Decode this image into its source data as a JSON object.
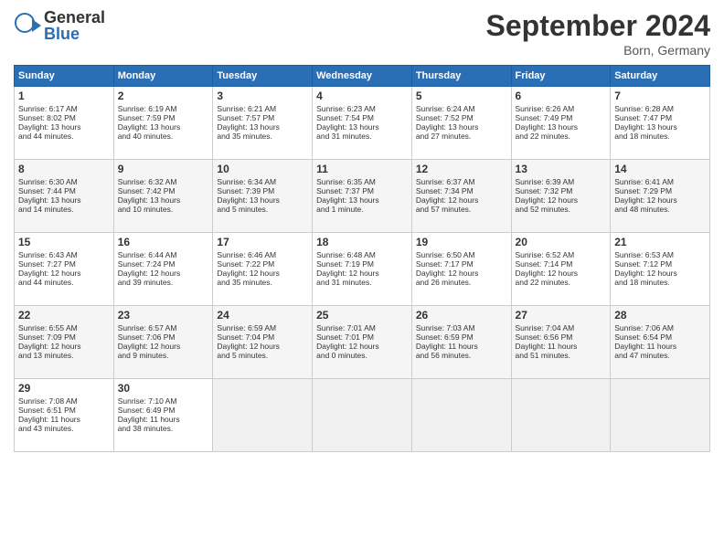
{
  "logo": {
    "general": "General",
    "blue": "Blue"
  },
  "title": "September 2024",
  "location": "Born, Germany",
  "days_header": [
    "Sunday",
    "Monday",
    "Tuesday",
    "Wednesday",
    "Thursday",
    "Friday",
    "Saturday"
  ],
  "weeks": [
    [
      {
        "num": "1",
        "info": "Sunrise: 6:17 AM\nSunset: 8:02 PM\nDaylight: 13 hours\nand 44 minutes."
      },
      {
        "num": "2",
        "info": "Sunrise: 6:19 AM\nSunset: 7:59 PM\nDaylight: 13 hours\nand 40 minutes."
      },
      {
        "num": "3",
        "info": "Sunrise: 6:21 AM\nSunset: 7:57 PM\nDaylight: 13 hours\nand 35 minutes."
      },
      {
        "num": "4",
        "info": "Sunrise: 6:23 AM\nSunset: 7:54 PM\nDaylight: 13 hours\nand 31 minutes."
      },
      {
        "num": "5",
        "info": "Sunrise: 6:24 AM\nSunset: 7:52 PM\nDaylight: 13 hours\nand 27 minutes."
      },
      {
        "num": "6",
        "info": "Sunrise: 6:26 AM\nSunset: 7:49 PM\nDaylight: 13 hours\nand 22 minutes."
      },
      {
        "num": "7",
        "info": "Sunrise: 6:28 AM\nSunset: 7:47 PM\nDaylight: 13 hours\nand 18 minutes."
      }
    ],
    [
      {
        "num": "8",
        "info": "Sunrise: 6:30 AM\nSunset: 7:44 PM\nDaylight: 13 hours\nand 14 minutes."
      },
      {
        "num": "9",
        "info": "Sunrise: 6:32 AM\nSunset: 7:42 PM\nDaylight: 13 hours\nand 10 minutes."
      },
      {
        "num": "10",
        "info": "Sunrise: 6:34 AM\nSunset: 7:39 PM\nDaylight: 13 hours\nand 5 minutes."
      },
      {
        "num": "11",
        "info": "Sunrise: 6:35 AM\nSunset: 7:37 PM\nDaylight: 13 hours\nand 1 minute."
      },
      {
        "num": "12",
        "info": "Sunrise: 6:37 AM\nSunset: 7:34 PM\nDaylight: 12 hours\nand 57 minutes."
      },
      {
        "num": "13",
        "info": "Sunrise: 6:39 AM\nSunset: 7:32 PM\nDaylight: 12 hours\nand 52 minutes."
      },
      {
        "num": "14",
        "info": "Sunrise: 6:41 AM\nSunset: 7:29 PM\nDaylight: 12 hours\nand 48 minutes."
      }
    ],
    [
      {
        "num": "15",
        "info": "Sunrise: 6:43 AM\nSunset: 7:27 PM\nDaylight: 12 hours\nand 44 minutes."
      },
      {
        "num": "16",
        "info": "Sunrise: 6:44 AM\nSunset: 7:24 PM\nDaylight: 12 hours\nand 39 minutes."
      },
      {
        "num": "17",
        "info": "Sunrise: 6:46 AM\nSunset: 7:22 PM\nDaylight: 12 hours\nand 35 minutes."
      },
      {
        "num": "18",
        "info": "Sunrise: 6:48 AM\nSunset: 7:19 PM\nDaylight: 12 hours\nand 31 minutes."
      },
      {
        "num": "19",
        "info": "Sunrise: 6:50 AM\nSunset: 7:17 PM\nDaylight: 12 hours\nand 26 minutes."
      },
      {
        "num": "20",
        "info": "Sunrise: 6:52 AM\nSunset: 7:14 PM\nDaylight: 12 hours\nand 22 minutes."
      },
      {
        "num": "21",
        "info": "Sunrise: 6:53 AM\nSunset: 7:12 PM\nDaylight: 12 hours\nand 18 minutes."
      }
    ],
    [
      {
        "num": "22",
        "info": "Sunrise: 6:55 AM\nSunset: 7:09 PM\nDaylight: 12 hours\nand 13 minutes."
      },
      {
        "num": "23",
        "info": "Sunrise: 6:57 AM\nSunset: 7:06 PM\nDaylight: 12 hours\nand 9 minutes."
      },
      {
        "num": "24",
        "info": "Sunrise: 6:59 AM\nSunset: 7:04 PM\nDaylight: 12 hours\nand 5 minutes."
      },
      {
        "num": "25",
        "info": "Sunrise: 7:01 AM\nSunset: 7:01 PM\nDaylight: 12 hours\nand 0 minutes."
      },
      {
        "num": "26",
        "info": "Sunrise: 7:03 AM\nSunset: 6:59 PM\nDaylight: 11 hours\nand 56 minutes."
      },
      {
        "num": "27",
        "info": "Sunrise: 7:04 AM\nSunset: 6:56 PM\nDaylight: 11 hours\nand 51 minutes."
      },
      {
        "num": "28",
        "info": "Sunrise: 7:06 AM\nSunset: 6:54 PM\nDaylight: 11 hours\nand 47 minutes."
      }
    ],
    [
      {
        "num": "29",
        "info": "Sunrise: 7:08 AM\nSunset: 6:51 PM\nDaylight: 11 hours\nand 43 minutes."
      },
      {
        "num": "30",
        "info": "Sunrise: 7:10 AM\nSunset: 6:49 PM\nDaylight: 11 hours\nand 38 minutes."
      },
      {
        "num": "",
        "info": ""
      },
      {
        "num": "",
        "info": ""
      },
      {
        "num": "",
        "info": ""
      },
      {
        "num": "",
        "info": ""
      },
      {
        "num": "",
        "info": ""
      }
    ]
  ]
}
